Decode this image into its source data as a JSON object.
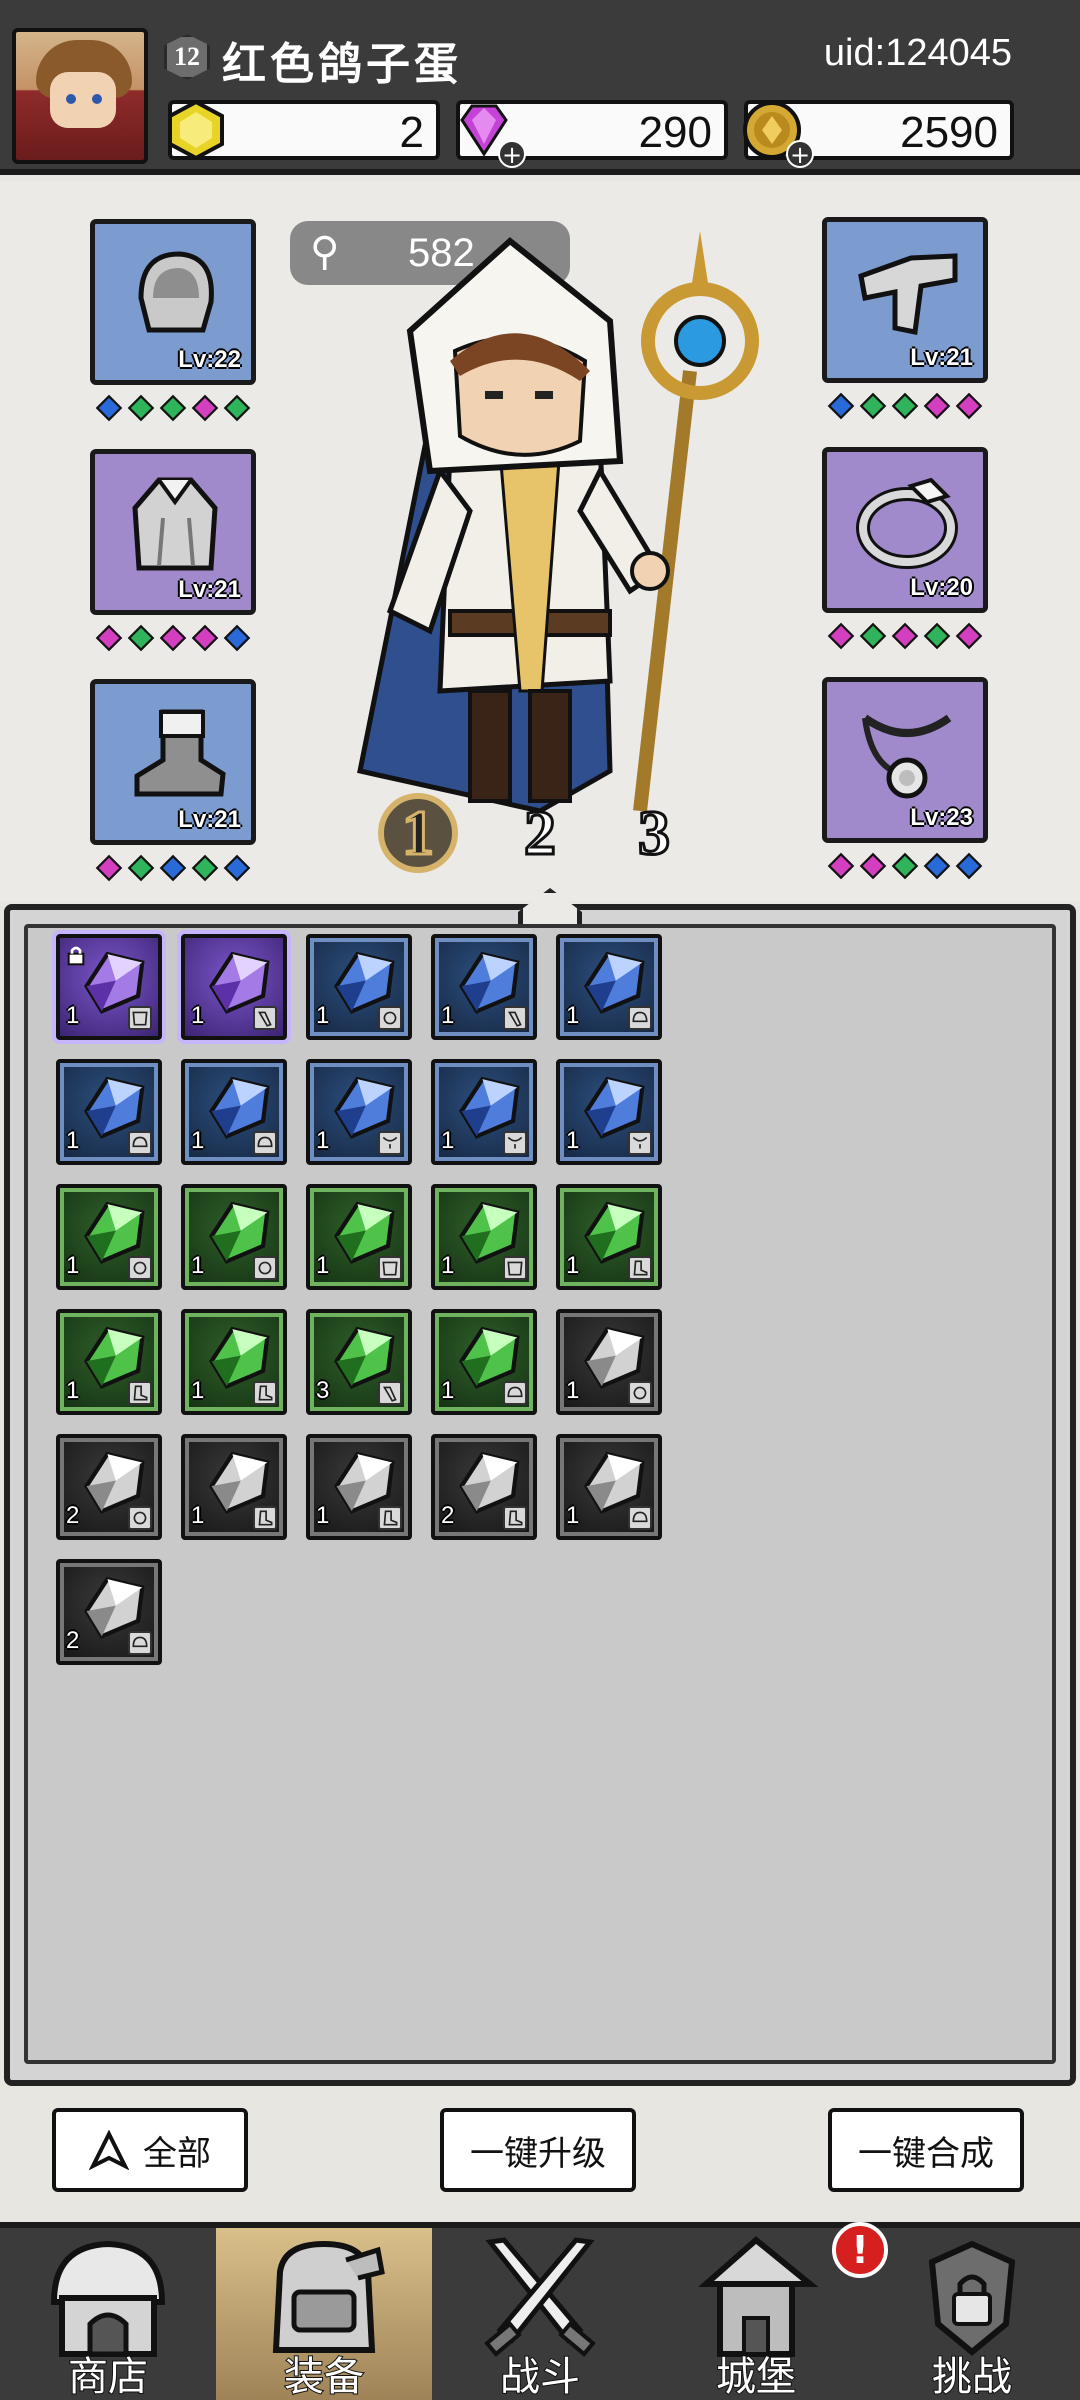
{
  "player": {
    "level": "12",
    "name": "红色鸽子蛋",
    "uid": "uid:124045"
  },
  "currency": [
    {
      "name": "gold-hexagon",
      "value": "2",
      "has_plus": false,
      "color": "#e8d327"
    },
    {
      "name": "purple-diamond",
      "value": "290",
      "has_plus": true,
      "color": "#c542d9"
    },
    {
      "name": "gold-coin",
      "value": "2590",
      "has_plus": true,
      "color": "#d4a933"
    }
  ],
  "power": {
    "icon": "key-icon",
    "value": "582"
  },
  "equipment": {
    "left": [
      {
        "slot": "helmet",
        "level": "Lv:22",
        "rarity": "blue",
        "gems": [
          "b",
          "g",
          "g",
          "p",
          "g"
        ]
      },
      {
        "slot": "cape",
        "level": "Lv:21",
        "rarity": "purple",
        "gems": [
          "p",
          "g",
          "p",
          "p",
          "b"
        ]
      },
      {
        "slot": "boots",
        "level": "Lv:21",
        "rarity": "blue",
        "gems": [
          "p",
          "g",
          "b",
          "g",
          "b"
        ]
      }
    ],
    "right": [
      {
        "slot": "bracer",
        "level": "Lv:21",
        "rarity": "blue",
        "gems": [
          "b",
          "g",
          "g",
          "p",
          "p"
        ]
      },
      {
        "slot": "ring",
        "level": "Lv:20",
        "rarity": "purple",
        "gems": [
          "p",
          "g",
          "p",
          "g",
          "p"
        ]
      },
      {
        "slot": "necklace",
        "level": "Lv:23",
        "rarity": "purple",
        "gems": [
          "p",
          "p",
          "g",
          "b",
          "b"
        ]
      }
    ]
  },
  "loadout_tabs": [
    "1",
    "2",
    "3"
  ],
  "active_tab": "1",
  "inventory": [
    {
      "rarity": "purple",
      "count": "1",
      "type": "cape",
      "locked": true
    },
    {
      "rarity": "purple",
      "count": "1",
      "type": "weapon",
      "locked": false
    },
    {
      "rarity": "blue",
      "count": "1",
      "type": "ring",
      "locked": false
    },
    {
      "rarity": "blue",
      "count": "1",
      "type": "weapon",
      "locked": false
    },
    {
      "rarity": "blue",
      "count": "1",
      "type": "helmet",
      "locked": false
    },
    {
      "rarity": "blue",
      "count": "1",
      "type": "helmet",
      "locked": false
    },
    {
      "rarity": "blue",
      "count": "1",
      "type": "helmet",
      "locked": false
    },
    {
      "rarity": "blue",
      "count": "1",
      "type": "necklace",
      "locked": false
    },
    {
      "rarity": "blue",
      "count": "1",
      "type": "necklace",
      "locked": false
    },
    {
      "rarity": "blue",
      "count": "1",
      "type": "necklace",
      "locked": false
    },
    {
      "rarity": "green",
      "count": "1",
      "type": "ring",
      "locked": false
    },
    {
      "rarity": "green",
      "count": "1",
      "type": "ring",
      "locked": false
    },
    {
      "rarity": "green",
      "count": "1",
      "type": "cape",
      "locked": false
    },
    {
      "rarity": "green",
      "count": "1",
      "type": "cape",
      "locked": false
    },
    {
      "rarity": "green",
      "count": "1",
      "type": "boots",
      "locked": false
    },
    {
      "rarity": "green",
      "count": "1",
      "type": "boots",
      "locked": false
    },
    {
      "rarity": "green",
      "count": "1",
      "type": "boots",
      "locked": false
    },
    {
      "rarity": "green",
      "count": "3",
      "type": "weapon",
      "locked": false
    },
    {
      "rarity": "green",
      "count": "1",
      "type": "helmet",
      "locked": false
    },
    {
      "rarity": "gray",
      "count": "1",
      "type": "ring",
      "locked": false
    },
    {
      "rarity": "gray",
      "count": "2",
      "type": "ring",
      "locked": false
    },
    {
      "rarity": "gray",
      "count": "1",
      "type": "boots",
      "locked": false
    },
    {
      "rarity": "gray",
      "count": "1",
      "type": "boots",
      "locked": false
    },
    {
      "rarity": "gray",
      "count": "2",
      "type": "boots",
      "locked": false
    },
    {
      "rarity": "gray",
      "count": "1",
      "type": "helmet",
      "locked": false
    },
    {
      "rarity": "gray",
      "count": "2",
      "type": "helmet",
      "locked": false
    }
  ],
  "buttons": {
    "filter_all": "全部",
    "upgrade_all": "一键升级",
    "merge_all": "一键合成"
  },
  "nav": [
    {
      "label": "商店",
      "icon": "shop-hut-icon",
      "active": false
    },
    {
      "label": "装备",
      "icon": "backpack-icon",
      "active": true
    },
    {
      "label": "战斗",
      "icon": "crossed-swords-icon",
      "active": false
    },
    {
      "label": "城堡",
      "icon": "castle-tower-icon",
      "active": false
    },
    {
      "label": "挑战",
      "icon": "locked-shield-icon",
      "active": false
    }
  ],
  "nav_alert": "!"
}
